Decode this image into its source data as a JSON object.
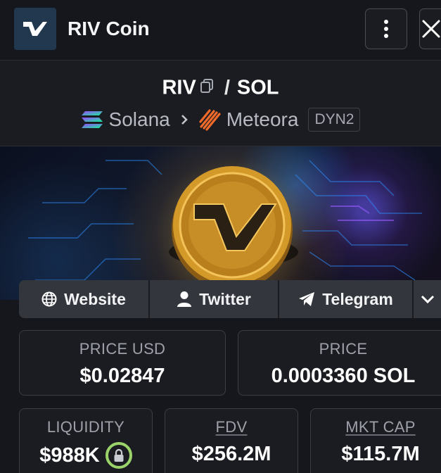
{
  "window": {
    "title": "RIV Coin"
  },
  "pair": {
    "base": "RIV",
    "separator": "/",
    "quote": "SOL",
    "chain": "Solana",
    "dex": "Meteora",
    "dex_badge": "DYN2"
  },
  "links": {
    "website": "Website",
    "twitter": "Twitter",
    "telegram": "Telegram"
  },
  "stats": {
    "price_usd_label": "PRICE USD",
    "price_usd_value": "$0.02847",
    "price_label": "PRICE",
    "price_value": "0.0003360 SOL",
    "liquidity_label": "LIQUIDITY",
    "liquidity_value": "$988K",
    "fdv_label": "FDV",
    "fdv_value": "$256.2M",
    "mktcap_label": "MKT CAP",
    "mktcap_value": "$115.7M"
  },
  "icons": {
    "logo": "riv-logo-icon",
    "more": "more-vertical-icon",
    "close": "close-icon",
    "copy": "copy-icon",
    "chain": "solana-icon",
    "dex": "meteora-icon",
    "website": "globe-icon",
    "twitter": "user-icon",
    "telegram": "telegram-icon",
    "expand": "chevron-down-icon",
    "liquidity_lock": "lock-icon"
  },
  "colors": {
    "background": "#16171c",
    "logo_bg": "#22384f",
    "lock_ring": "#9bd36b"
  }
}
